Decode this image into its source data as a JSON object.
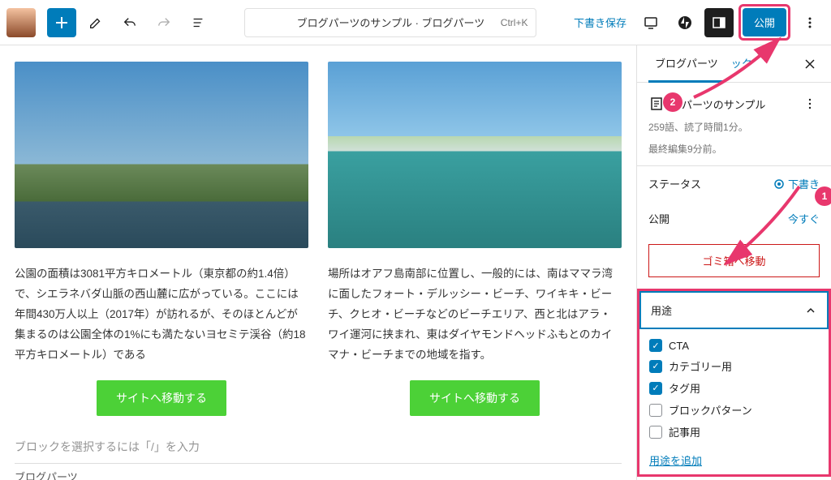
{
  "toolbar": {
    "doc_title": "ブログパーツのサンプル · ブログパーツ",
    "shortcut": "Ctrl+K",
    "save_draft": "下書き保存",
    "publish": "公開"
  },
  "editor": {
    "cards": [
      {
        "text": "公園の面積は3081平方キロメートル（東京都の約1.4倍）で、シエラネバダ山脈の西山麓に広がっている。ここには年間430万人以上（2017年）が訪れるが、そのほとんどが集まるのは公園全体の1%にも満たないヨセミテ渓谷（約18平方キロメートル）である",
        "button": "サイトへ移動する"
      },
      {
        "text": "場所はオアフ島南部に位置し、一般的には、南はママラ湾に面したフォート・デルッシー・ビーチ、ワイキキ・ビーチ、クヒオ・ビーチなどのビーチエリア、西と北はアラ・ワイ運河に挟まれ、東はダイヤモンドヘッドふもとのカイマナ・ビーチまでの地域を指す。",
        "button": "サイトへ移動する"
      }
    ],
    "placeholder": "ブロックを選択するには「/」を入力",
    "bottom_label": "ブログパーツ"
  },
  "sidebar": {
    "tabs": {
      "main": "ブログパーツ",
      "block": "ック"
    },
    "doc_title": "グパーツのサンプル",
    "meta_words": "259語、読了時間1分。",
    "meta_edited": "最終編集9分前。",
    "status_label": "ステータス",
    "status_value": "下書き",
    "publish_label": "公開",
    "publish_value": "今すぐ",
    "trash": "ゴミ箱へ移動",
    "usage_label": "用途",
    "usage_items": [
      {
        "label": "CTA",
        "checked": true
      },
      {
        "label": "カテゴリー用",
        "checked": true
      },
      {
        "label": "タグ用",
        "checked": true
      },
      {
        "label": "ブロックパターン",
        "checked": false
      },
      {
        "label": "記事用",
        "checked": false
      }
    ],
    "add_usage": "用途を追加"
  },
  "annotations": {
    "badge1": "1",
    "badge2": "2"
  }
}
